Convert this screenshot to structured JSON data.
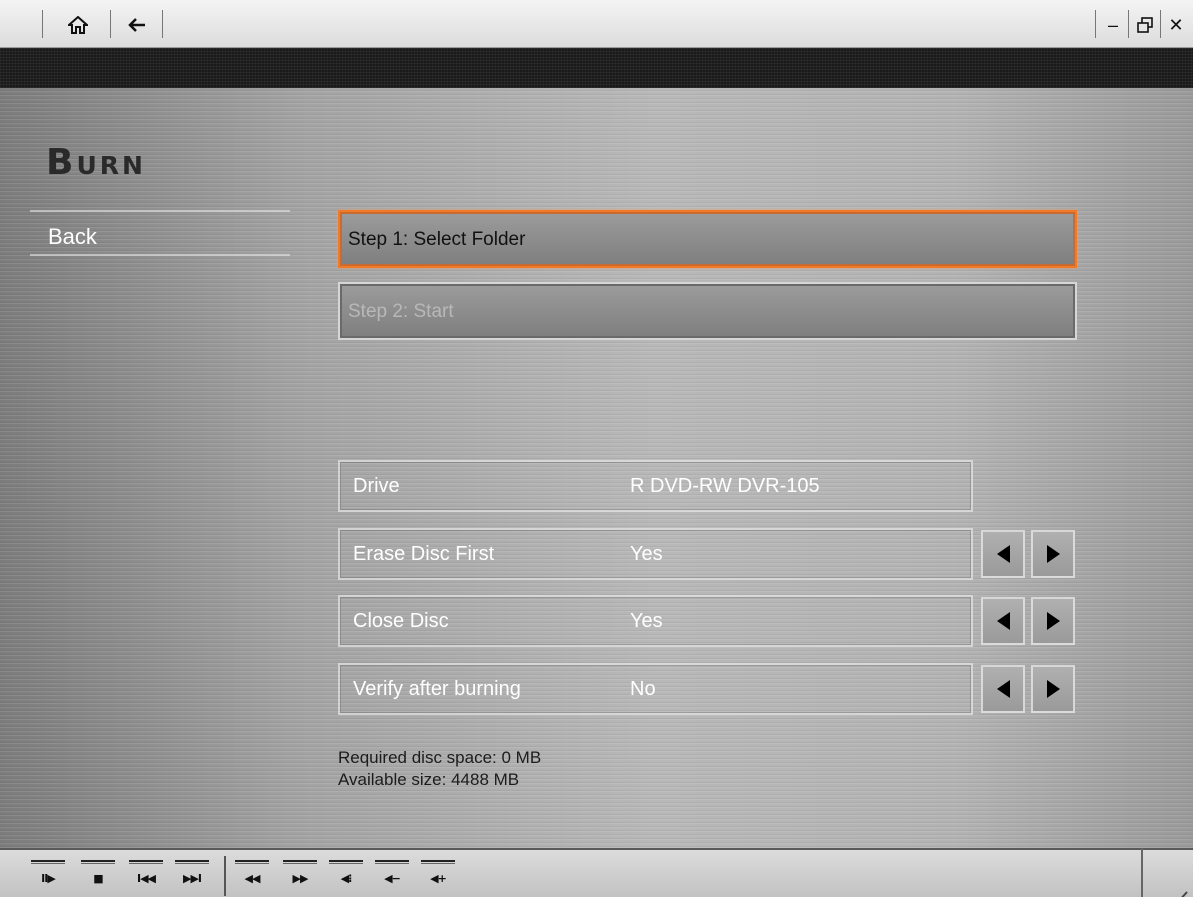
{
  "titlebar": {
    "home_icon": "home-icon",
    "back_icon": "back-arrow-icon",
    "minimize_label": "–",
    "restore_label": "🗗",
    "close_label": "✕"
  },
  "page": {
    "title": "Burn",
    "back_label": "Back"
  },
  "steps": [
    {
      "label": "Step 1: Select Folder",
      "state": "active"
    },
    {
      "label": "Step 2: Start",
      "state": "disabled"
    }
  ],
  "options": [
    {
      "label": "Drive",
      "value": "R DVD-RW DVR-105",
      "has_arrows": false
    },
    {
      "label": "Erase Disc First",
      "value": "Yes",
      "has_arrows": true
    },
    {
      "label": "Close Disc",
      "value": "Yes",
      "has_arrows": true
    },
    {
      "label": "Verify after burning",
      "value": "No",
      "has_arrows": true
    }
  ],
  "info": {
    "required": "Required disc space: 0 MB",
    "available": "Available size: 4488 MB"
  },
  "controls": [
    {
      "name": "play-pause",
      "glyph": "II▶"
    },
    {
      "name": "stop",
      "glyph": "■"
    },
    {
      "name": "previous",
      "glyph": "I◀◀"
    },
    {
      "name": "next",
      "glyph": "▶▶I"
    },
    {
      "name": "rewind",
      "glyph": "◀◀"
    },
    {
      "name": "fast-forward",
      "glyph": "▶▶"
    },
    {
      "name": "mute",
      "glyph": "◀⁝"
    },
    {
      "name": "volume-down",
      "glyph": "◀−"
    },
    {
      "name": "volume-up",
      "glyph": "◀+"
    }
  ],
  "colors": {
    "accent_focus": "#f07a28"
  }
}
